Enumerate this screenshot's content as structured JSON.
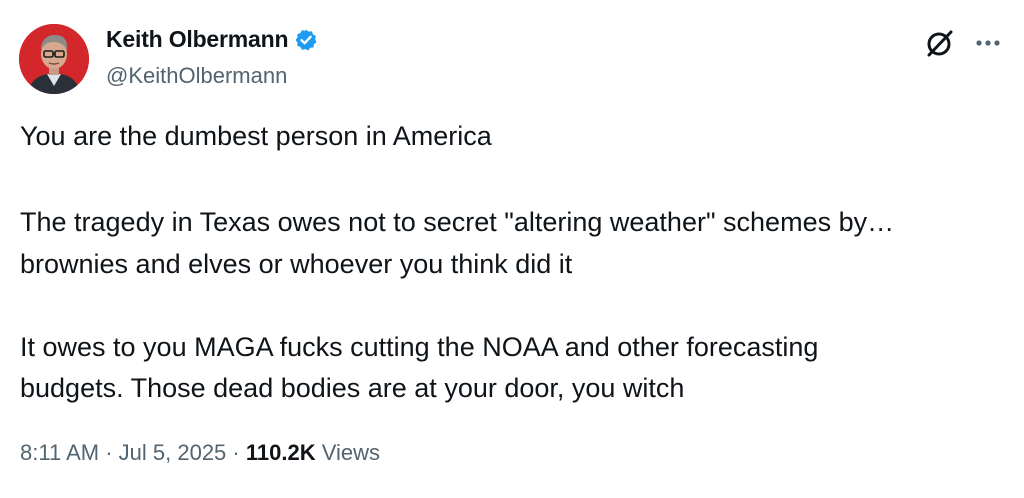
{
  "author": {
    "name": "Keith Olbermann",
    "handle": "@KeithOlbermann",
    "verified": true,
    "avatar_bg": "#d3272b",
    "verified_color": "#1d9bf0"
  },
  "actions": {
    "grok_icon": "grok-slash-icon",
    "more_icon": "more-dots-icon"
  },
  "tweet": {
    "lines": [
      "You are the dumbest person in America",
      "The tragedy in Texas owes not to secret \"altering weather\" schemes by…",
      "brownies and elves or whoever you think did it",
      "It owes to you MAGA fucks cutting the NOAA and other forecasting",
      "budgets. Those dead bodies are at your door, you witch"
    ]
  },
  "meta": {
    "time": "8:11 AM",
    "separator": " · ",
    "date": "Jul 5, 2025",
    "views_count": "110.2K",
    "views_label": "Views"
  },
  "colors": {
    "text": "#0f1419",
    "secondary": "#536471"
  }
}
